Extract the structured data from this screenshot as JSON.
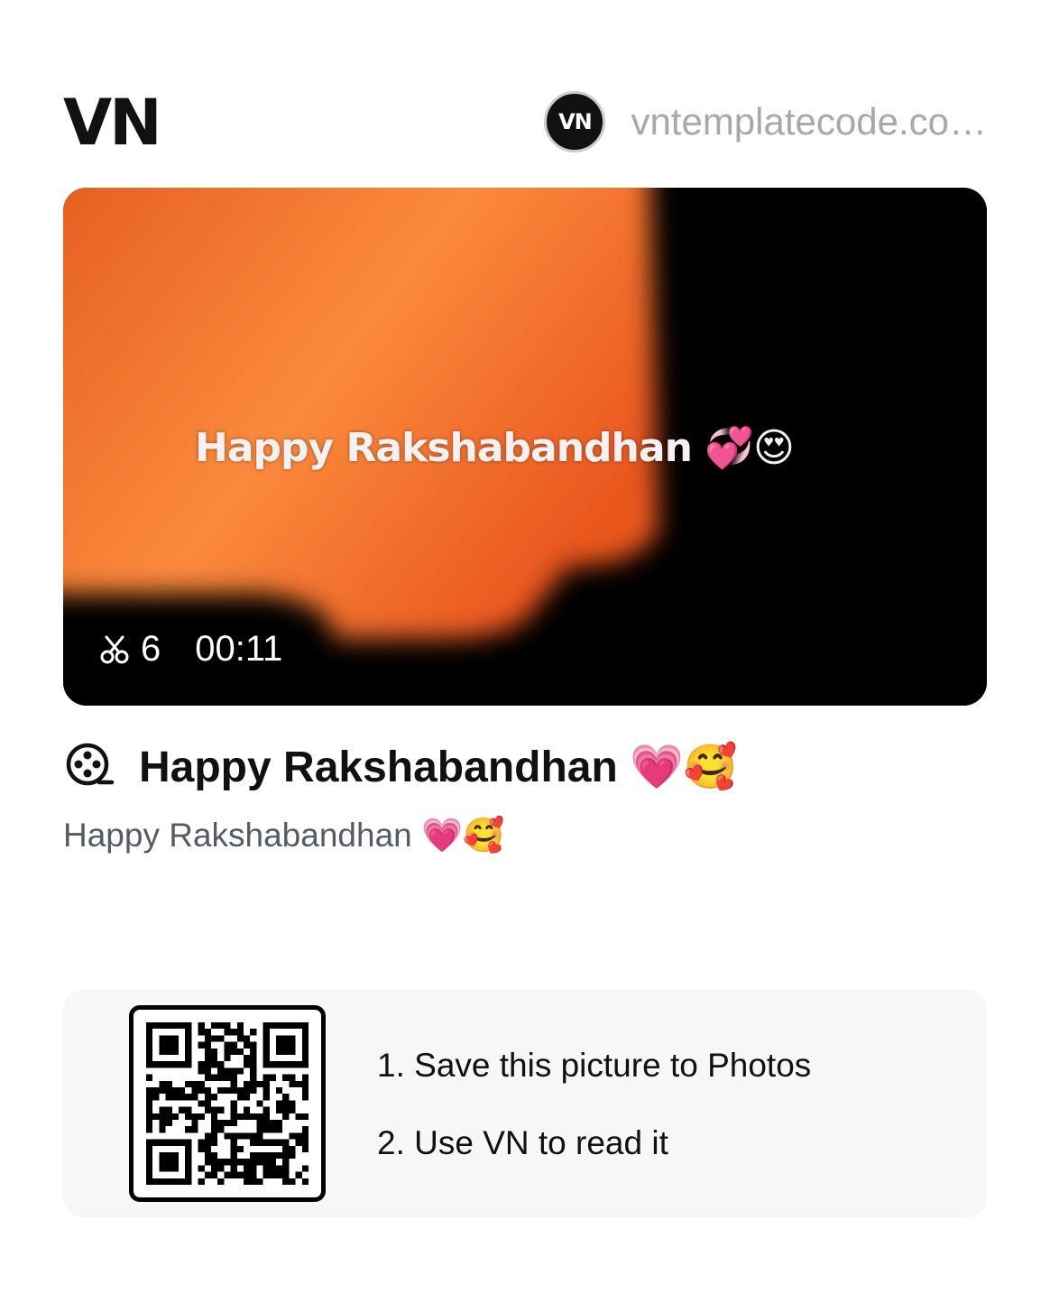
{
  "brand": {
    "logo_text": "VN"
  },
  "author": {
    "avatar_text": "VN",
    "name": "vntemplatecode.co…"
  },
  "video": {
    "caption": "Happy Rakshabandhan 💞😍",
    "clip_count": "6",
    "duration": "00:11",
    "icons": {
      "clips": "scissors-icon"
    }
  },
  "template": {
    "title": "Happy Rakshabandhan 💗🥰",
    "description": "Happy Rakshabandhan 💗🥰",
    "icons": {
      "title": "film-reel-icon"
    }
  },
  "qr": {
    "step1": "1. Save this picture to Photos",
    "step2": "2. Use VN to read it"
  },
  "colors": {
    "accent_orange": "#f07a2c",
    "text_gray": "#a8a8a8",
    "card_bg": "#f7f7f7"
  }
}
